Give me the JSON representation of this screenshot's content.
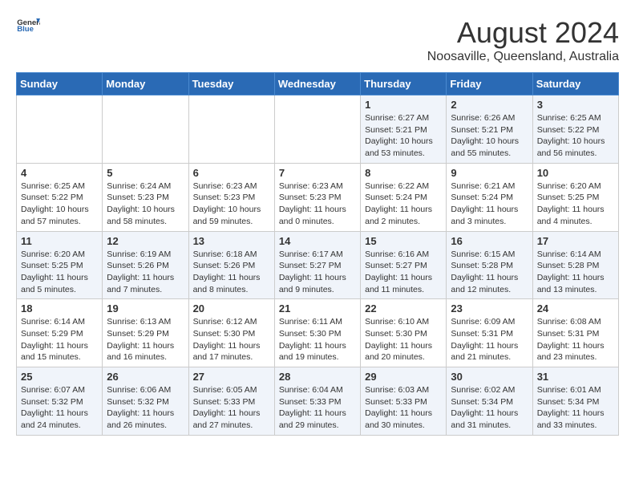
{
  "header": {
    "logo_general": "General",
    "logo_blue": "Blue",
    "month_year": "August 2024",
    "location": "Noosaville, Queensland, Australia"
  },
  "days_of_week": [
    "Sunday",
    "Monday",
    "Tuesday",
    "Wednesday",
    "Thursday",
    "Friday",
    "Saturday"
  ],
  "weeks": [
    [
      {
        "day": "",
        "info": ""
      },
      {
        "day": "",
        "info": ""
      },
      {
        "day": "",
        "info": ""
      },
      {
        "day": "",
        "info": ""
      },
      {
        "day": "1",
        "info": "Sunrise: 6:27 AM\nSunset: 5:21 PM\nDaylight: 10 hours\nand 53 minutes."
      },
      {
        "day": "2",
        "info": "Sunrise: 6:26 AM\nSunset: 5:21 PM\nDaylight: 10 hours\nand 55 minutes."
      },
      {
        "day": "3",
        "info": "Sunrise: 6:25 AM\nSunset: 5:22 PM\nDaylight: 10 hours\nand 56 minutes."
      }
    ],
    [
      {
        "day": "4",
        "info": "Sunrise: 6:25 AM\nSunset: 5:22 PM\nDaylight: 10 hours\nand 57 minutes."
      },
      {
        "day": "5",
        "info": "Sunrise: 6:24 AM\nSunset: 5:23 PM\nDaylight: 10 hours\nand 58 minutes."
      },
      {
        "day": "6",
        "info": "Sunrise: 6:23 AM\nSunset: 5:23 PM\nDaylight: 10 hours\nand 59 minutes."
      },
      {
        "day": "7",
        "info": "Sunrise: 6:23 AM\nSunset: 5:23 PM\nDaylight: 11 hours\nand 0 minutes."
      },
      {
        "day": "8",
        "info": "Sunrise: 6:22 AM\nSunset: 5:24 PM\nDaylight: 11 hours\nand 2 minutes."
      },
      {
        "day": "9",
        "info": "Sunrise: 6:21 AM\nSunset: 5:24 PM\nDaylight: 11 hours\nand 3 minutes."
      },
      {
        "day": "10",
        "info": "Sunrise: 6:20 AM\nSunset: 5:25 PM\nDaylight: 11 hours\nand 4 minutes."
      }
    ],
    [
      {
        "day": "11",
        "info": "Sunrise: 6:20 AM\nSunset: 5:25 PM\nDaylight: 11 hours\nand 5 minutes."
      },
      {
        "day": "12",
        "info": "Sunrise: 6:19 AM\nSunset: 5:26 PM\nDaylight: 11 hours\nand 7 minutes."
      },
      {
        "day": "13",
        "info": "Sunrise: 6:18 AM\nSunset: 5:26 PM\nDaylight: 11 hours\nand 8 minutes."
      },
      {
        "day": "14",
        "info": "Sunrise: 6:17 AM\nSunset: 5:27 PM\nDaylight: 11 hours\nand 9 minutes."
      },
      {
        "day": "15",
        "info": "Sunrise: 6:16 AM\nSunset: 5:27 PM\nDaylight: 11 hours\nand 11 minutes."
      },
      {
        "day": "16",
        "info": "Sunrise: 6:15 AM\nSunset: 5:28 PM\nDaylight: 11 hours\nand 12 minutes."
      },
      {
        "day": "17",
        "info": "Sunrise: 6:14 AM\nSunset: 5:28 PM\nDaylight: 11 hours\nand 13 minutes."
      }
    ],
    [
      {
        "day": "18",
        "info": "Sunrise: 6:14 AM\nSunset: 5:29 PM\nDaylight: 11 hours\nand 15 minutes."
      },
      {
        "day": "19",
        "info": "Sunrise: 6:13 AM\nSunset: 5:29 PM\nDaylight: 11 hours\nand 16 minutes."
      },
      {
        "day": "20",
        "info": "Sunrise: 6:12 AM\nSunset: 5:30 PM\nDaylight: 11 hours\nand 17 minutes."
      },
      {
        "day": "21",
        "info": "Sunrise: 6:11 AM\nSunset: 5:30 PM\nDaylight: 11 hours\nand 19 minutes."
      },
      {
        "day": "22",
        "info": "Sunrise: 6:10 AM\nSunset: 5:30 PM\nDaylight: 11 hours\nand 20 minutes."
      },
      {
        "day": "23",
        "info": "Sunrise: 6:09 AM\nSunset: 5:31 PM\nDaylight: 11 hours\nand 21 minutes."
      },
      {
        "day": "24",
        "info": "Sunrise: 6:08 AM\nSunset: 5:31 PM\nDaylight: 11 hours\nand 23 minutes."
      }
    ],
    [
      {
        "day": "25",
        "info": "Sunrise: 6:07 AM\nSunset: 5:32 PM\nDaylight: 11 hours\nand 24 minutes."
      },
      {
        "day": "26",
        "info": "Sunrise: 6:06 AM\nSunset: 5:32 PM\nDaylight: 11 hours\nand 26 minutes."
      },
      {
        "day": "27",
        "info": "Sunrise: 6:05 AM\nSunset: 5:33 PM\nDaylight: 11 hours\nand 27 minutes."
      },
      {
        "day": "28",
        "info": "Sunrise: 6:04 AM\nSunset: 5:33 PM\nDaylight: 11 hours\nand 29 minutes."
      },
      {
        "day": "29",
        "info": "Sunrise: 6:03 AM\nSunset: 5:33 PM\nDaylight: 11 hours\nand 30 minutes."
      },
      {
        "day": "30",
        "info": "Sunrise: 6:02 AM\nSunset: 5:34 PM\nDaylight: 11 hours\nand 31 minutes."
      },
      {
        "day": "31",
        "info": "Sunrise: 6:01 AM\nSunset: 5:34 PM\nDaylight: 11 hours\nand 33 minutes."
      }
    ]
  ]
}
